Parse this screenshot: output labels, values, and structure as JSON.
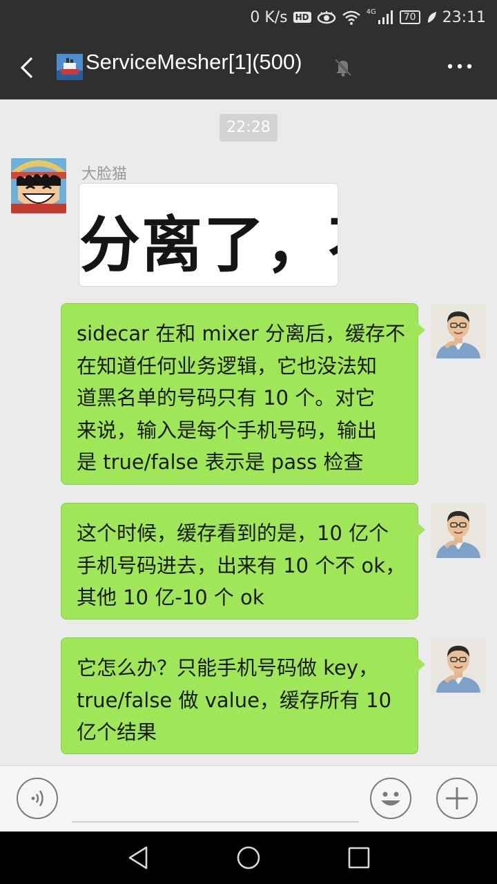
{
  "status_bar": {
    "net_speed": "0 K/s",
    "hd_label": "HD",
    "network_label": "4G",
    "battery": "70",
    "time": "23:11"
  },
  "header": {
    "title": "ServiceMesher[1](500)",
    "icons": [
      "back-arrow-icon",
      "ship-group-icon",
      "mute-bell-icon",
      "more-dots-icon"
    ]
  },
  "chat": {
    "timestamp": "22:28",
    "incoming": {
      "sender": "大脸猫",
      "image_text": "分离了，不"
    },
    "outgoing": [
      {
        "lines": [
          "sidecar 在和 mixer 分离后，缓存不",
          "在知道任何业务逻辑，它也没法知",
          "道黑名单的号码只有 10 个。对它",
          "来说，输入是每个手机号码，输出",
          "是 true/false 表示是 pass 检查"
        ]
      },
      {
        "lines": [
          "这个时候，缓存看到的是，10 亿个",
          "手机号码进去，出来有 10 个不 ok，",
          "其他 10 亿-10 个 ok"
        ]
      },
      {
        "lines": [
          "它怎么办？只能手机号码做 key，",
          "true/false 做 value，缓存所有 10",
          "亿个结果"
        ]
      }
    ]
  },
  "input_bar": {
    "icons": [
      "voice-icon",
      "emoji-icon",
      "plus-icon"
    ]
  },
  "nav_bar": {
    "icons": [
      "back-triangle-icon",
      "home-circle-icon",
      "recents-square-icon"
    ]
  },
  "colors": {
    "bar_bg": "#2f2f2f",
    "chat_bg": "#ebebeb",
    "bubble_green": "#9fe658"
  }
}
